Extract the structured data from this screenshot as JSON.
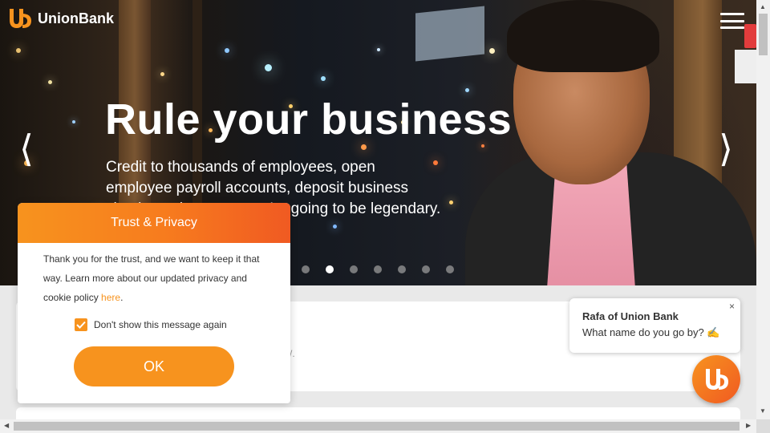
{
  "header": {
    "brand_name": "UnionBank",
    "logo_icon": "ub-logo-icon",
    "menu_icon": "hamburger-menu-icon"
  },
  "hero": {
    "title": "Rule your business",
    "subtitle": "Credit to thousands of employees, open employee payroll accounts, deposit business checks and more — you're going to be legendary.",
    "prev_icon": "chevron-left-icon",
    "next_icon": "chevron-right-icon",
    "slide_count": 7,
    "active_slide": 2
  },
  "privacy_modal": {
    "title": "Trust & Privacy",
    "body_text": "Thank you for the trust, and we want to keep it that way. Learn more about our updated privacy and cookie policy ",
    "link_text": "here",
    "body_end": ".",
    "checkbox_label": "Don't show this message again",
    "checkbox_checked": true,
    "ok_label": "OK"
  },
  "chat": {
    "agent_name": "Rafa of Union Bank",
    "message": "What name do you go by?",
    "emoji": "✍",
    "close_label": "×"
  },
  "colors": {
    "brand_orange": "#f7931e",
    "brand_red_orange": "#f05a22"
  }
}
